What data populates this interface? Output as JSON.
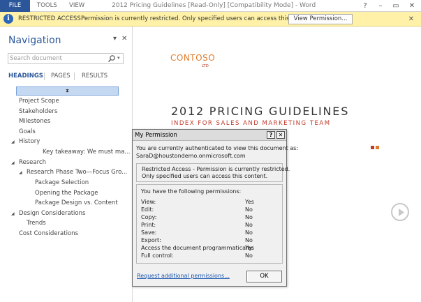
{
  "ribbon": {
    "file_tab": "FILE",
    "tabs": [
      "TOOLS",
      "VIEW"
    ],
    "window_title": "2012 Pricing Guidelines [Read-Only] [Compatibility Mode] - Word",
    "window_buttons": {
      "help": "?",
      "minimize": "–",
      "restore": "▭",
      "close": "✕"
    }
  },
  "infobar": {
    "title": "RESTRICTED ACCESS",
    "message": "Permission is currently restricted. Only specified users can access this content.",
    "button_label": "View Permission...",
    "close": "✕"
  },
  "navigation": {
    "title": "Navigation",
    "search_placeholder": "Search document",
    "tabs": [
      "HEADINGS",
      "PAGES",
      "RESULTS"
    ],
    "active_tab": "HEADINGS",
    "headings": [
      {
        "label": "Project Scope",
        "level": 1,
        "expander": ""
      },
      {
        "label": "Stakeholders",
        "level": 1,
        "expander": ""
      },
      {
        "label": "Milestones",
        "level": 1,
        "expander": ""
      },
      {
        "label": "Goals",
        "level": 1,
        "expander": ""
      },
      {
        "label": "History",
        "level": 1,
        "expander": "expanded"
      },
      {
        "label": "Key takeaway: We must ma...",
        "level": 3,
        "expander": ""
      },
      {
        "label": "Research",
        "level": 1,
        "expander": "expanded"
      },
      {
        "label": "Research Phase Two—Focus Gro...",
        "level": 2,
        "expander": "expanded"
      },
      {
        "label": "Package Selection",
        "level": 3,
        "expander": ""
      },
      {
        "label": "Opening the Package",
        "level": 3,
        "expander": ""
      },
      {
        "label": "Package Design vs. Content",
        "level": 3,
        "expander": ""
      },
      {
        "label": "Design Considerations",
        "level": 1,
        "expander": "expanded"
      },
      {
        "label": "Trends",
        "level": 2,
        "expander": ""
      },
      {
        "label": "Cost Considerations",
        "level": 1,
        "expander": ""
      }
    ]
  },
  "document": {
    "logo_text": "CONTOSO",
    "logo_sub": "LTD",
    "title": "2012 PRICING GUIDELINES",
    "subtitle": "INDEX FOR SALES AND MARKETING TEAM",
    "accent_colors": [
      "#c0392b",
      "#e07b2c"
    ]
  },
  "dialog": {
    "title": "My Permission",
    "auth_line": "You are currently authenticated to view this document as:",
    "user": "SaraD@houstondemo.onmicrosoft.com",
    "restricted_line1": "Restricted Access - Permission is currently restricted.",
    "restricted_line2": "Only specified users can access this content.",
    "permissions_heading": "You have the following permissions:",
    "permissions": [
      {
        "label": "View:",
        "value": "Yes"
      },
      {
        "label": "Edit:",
        "value": "No"
      },
      {
        "label": "Copy:",
        "value": "No"
      },
      {
        "label": "Print:",
        "value": "No"
      },
      {
        "label": "Save:",
        "value": "No"
      },
      {
        "label": "Export:",
        "value": "No"
      },
      {
        "label": "Access the document programmatically:",
        "value": "Yes"
      },
      {
        "label": "Full control:",
        "value": "No"
      }
    ],
    "link_label": "Request additional permissions...",
    "ok_label": "OK",
    "help_btn": "?",
    "close_btn": "✕"
  }
}
